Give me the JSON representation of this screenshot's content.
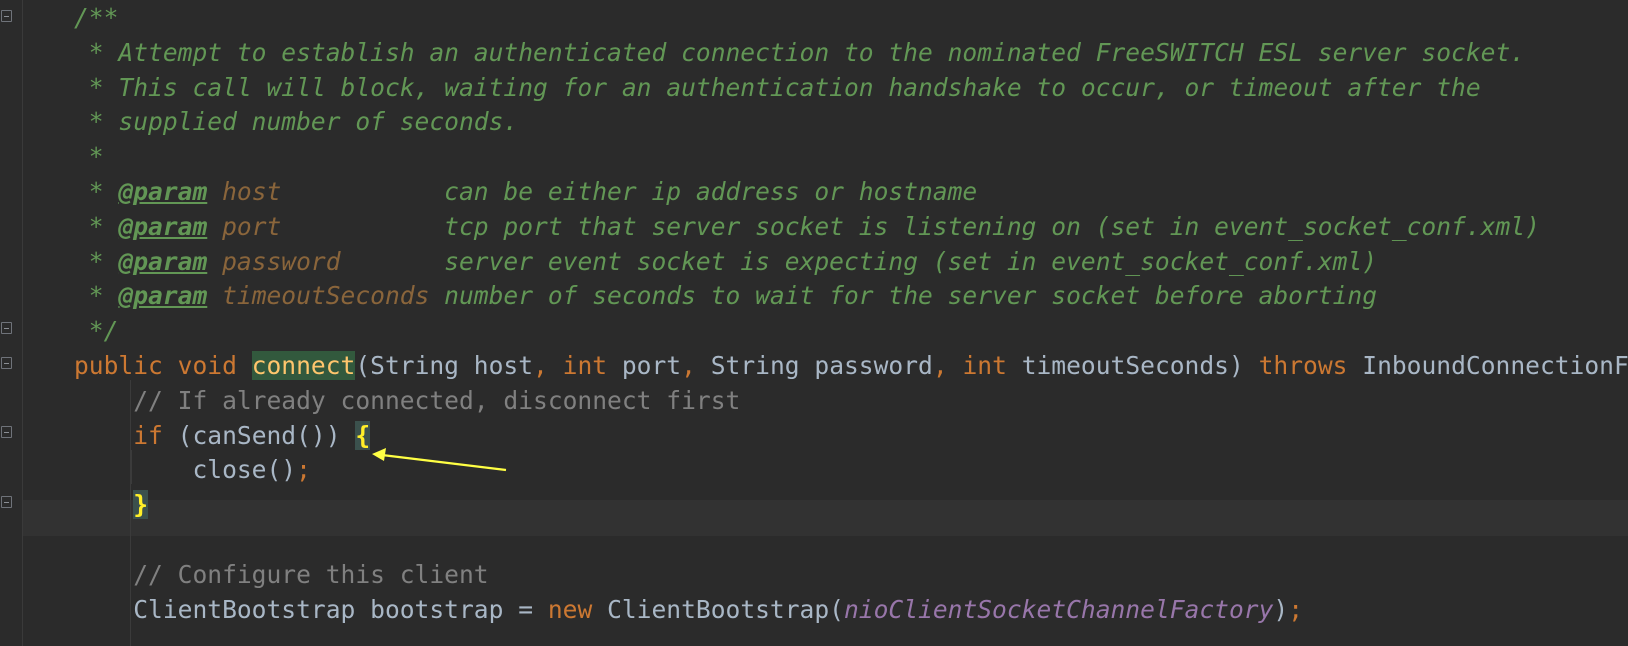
{
  "editor": {
    "lines": [
      {
        "parts": [
          {
            "t": "/**",
            "c": "doc"
          }
        ]
      },
      {
        "parts": [
          {
            "t": " * Attempt to establish an authenticated connection to the nominated FreeSWITCH ESL server socket.",
            "c": "doc"
          }
        ]
      },
      {
        "parts": [
          {
            "t": " * This call will block, waiting for an authentication handshake to occur, or timeout after the",
            "c": "doc"
          }
        ]
      },
      {
        "parts": [
          {
            "t": " * supplied number of seconds.",
            "c": "doc"
          }
        ]
      },
      {
        "parts": [
          {
            "t": " *",
            "c": "doc"
          }
        ]
      },
      {
        "parts": [
          {
            "t": " * ",
            "c": "doc"
          },
          {
            "t": "@param",
            "c": "doc-tag"
          },
          {
            "t": " ",
            "c": "doc"
          },
          {
            "t": "host",
            "c": "doc-param"
          },
          {
            "t": "           can be either ip address or hostname",
            "c": "doc"
          }
        ]
      },
      {
        "parts": [
          {
            "t": " * ",
            "c": "doc"
          },
          {
            "t": "@param",
            "c": "doc-tag"
          },
          {
            "t": " ",
            "c": "doc"
          },
          {
            "t": "port",
            "c": "doc-param"
          },
          {
            "t": "           tcp port that server socket is listening on (set in event_socket_conf.xml)",
            "c": "doc"
          }
        ]
      },
      {
        "parts": [
          {
            "t": " * ",
            "c": "doc"
          },
          {
            "t": "@param",
            "c": "doc-tag"
          },
          {
            "t": " ",
            "c": "doc"
          },
          {
            "t": "password",
            "c": "doc-param"
          },
          {
            "t": "       server event socket is expecting (set in event_socket_conf.xml)",
            "c": "doc"
          }
        ]
      },
      {
        "parts": [
          {
            "t": " * ",
            "c": "doc"
          },
          {
            "t": "@param",
            "c": "doc-tag"
          },
          {
            "t": " ",
            "c": "doc"
          },
          {
            "t": "timeoutSeconds",
            "c": "doc-param"
          },
          {
            "t": " number of seconds to wait for the server socket before aborting",
            "c": "doc"
          }
        ]
      },
      {
        "parts": [
          {
            "t": " */",
            "c": "doc"
          }
        ]
      },
      {
        "parts": [
          {
            "t": "public void ",
            "c": "kw"
          },
          {
            "t": "connect",
            "c": "method-hl"
          },
          {
            "t": "(String host",
            "c": "plain"
          },
          {
            "t": ", int ",
            "c": "kw"
          },
          {
            "t": "port",
            "c": "plain"
          },
          {
            "t": ", ",
            "c": "kw"
          },
          {
            "t": "String password",
            "c": "plain"
          },
          {
            "t": ", int ",
            "c": "kw"
          },
          {
            "t": "timeoutSeconds) ",
            "c": "plain"
          },
          {
            "t": "throws ",
            "c": "kw"
          },
          {
            "t": "InboundConnectionFailure",
            "c": "plain"
          }
        ]
      },
      {
        "parts": [
          {
            "t": "    // If already connected, disconnect first",
            "c": "comment"
          }
        ]
      },
      {
        "parts": [
          {
            "t": "    ",
            "c": "plain"
          },
          {
            "t": "if ",
            "c": "kw"
          },
          {
            "t": "(canSend()) ",
            "c": "plain"
          },
          {
            "t": "{",
            "c": "brace-hl"
          }
        ]
      },
      {
        "parts": [
          {
            "t": "        close()",
            "c": "plain"
          },
          {
            "t": ";",
            "c": "kw"
          }
        ]
      },
      {
        "parts": [
          {
            "t": "    ",
            "c": "plain"
          },
          {
            "t": "}",
            "c": "brace-hl"
          }
        ]
      },
      {
        "parts": [
          {
            "t": "",
            "c": "plain"
          }
        ]
      },
      {
        "parts": [
          {
            "t": "    // Configure this client",
            "c": "comment"
          }
        ]
      },
      {
        "parts": [
          {
            "t": "    ClientBootstrap bootstrap = ",
            "c": "plain"
          },
          {
            "t": "new ",
            "c": "kw"
          },
          {
            "t": "ClientBootstrap(",
            "c": "plain"
          },
          {
            "t": "nioClientSocketChannelFactory",
            "c": "field"
          },
          {
            "t": ")",
            "c": "plain"
          },
          {
            "t": ";",
            "c": "kw"
          }
        ]
      }
    ]
  },
  "annotation": {
    "arrow_color": "#ffff44",
    "points_to": "opening-brace"
  }
}
